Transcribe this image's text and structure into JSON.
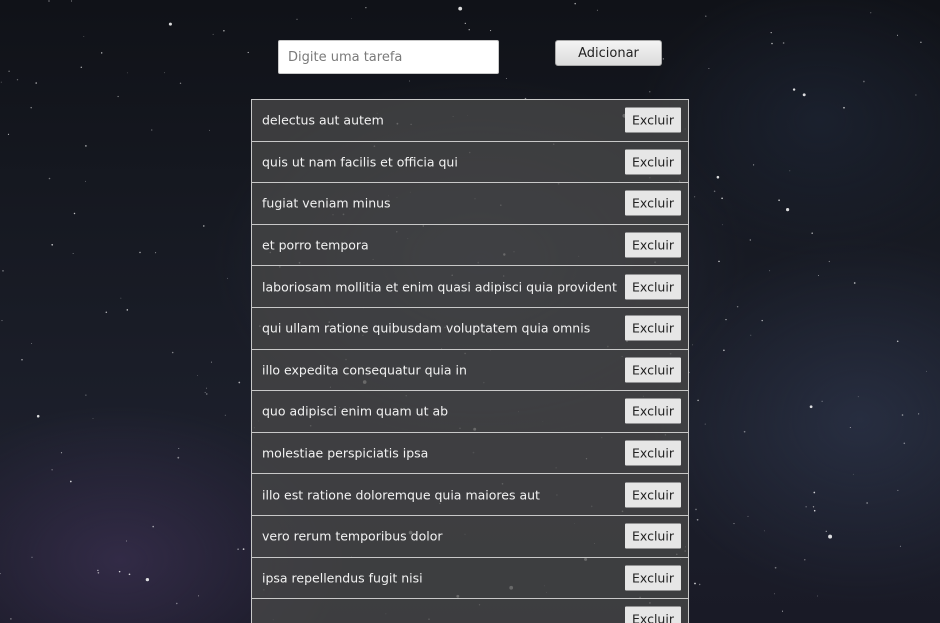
{
  "input": {
    "value": "",
    "placeholder": "Digite uma tarefa"
  },
  "add_button_label": "Adicionar",
  "tasks": [
    {
      "text": "delectus aut autem",
      "delete_label": "Excluir"
    },
    {
      "text": "quis ut nam facilis et officia qui",
      "delete_label": "Excluir"
    },
    {
      "text": "fugiat veniam minus",
      "delete_label": "Excluir"
    },
    {
      "text": "et porro tempora",
      "delete_label": "Excluir"
    },
    {
      "text": "laboriosam mollitia et enim quasi adipisci quia provident illum",
      "delete_label": "Excluir"
    },
    {
      "text": "qui ullam ratione quibusdam voluptatem quia omnis",
      "delete_label": "Excluir"
    },
    {
      "text": "illo expedita consequatur quia in",
      "delete_label": "Excluir"
    },
    {
      "text": "quo adipisci enim quam ut ab",
      "delete_label": "Excluir"
    },
    {
      "text": "molestiae perspiciatis ipsa",
      "delete_label": "Excluir"
    },
    {
      "text": "illo est ratione doloremque quia maiores aut",
      "delete_label": "Excluir"
    },
    {
      "text": "vero rerum temporibus dolor",
      "delete_label": "Excluir"
    },
    {
      "text": "ipsa repellendus fugit nisi",
      "delete_label": "Excluir"
    },
    {
      "text": "",
      "delete_label": "Excluir"
    }
  ],
  "colors": {
    "item_background": "#484848",
    "item_border": "#c8c8c8",
    "item_text": "#f2f2f2",
    "button_background": "#e6e6e6"
  }
}
